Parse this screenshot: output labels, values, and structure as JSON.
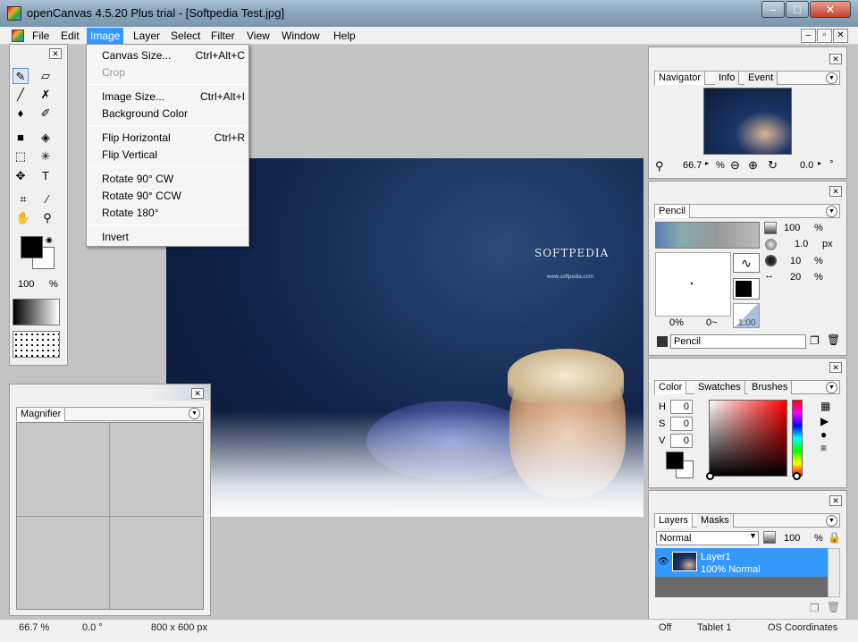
{
  "window": {
    "title": "openCanvas 4.5.20 Plus trial - [Softpedia Test.jpg]",
    "min": "–",
    "max": "□",
    "close": "✕"
  },
  "menubar": {
    "items": [
      "File",
      "Edit",
      "Image",
      "Layer",
      "Select",
      "Filter",
      "View",
      "Window",
      "Help"
    ],
    "mdi": [
      "–",
      "▫",
      "✕"
    ]
  },
  "image_menu": {
    "items": [
      {
        "label": "Canvas Size...",
        "shortcut": "Ctrl+Alt+C"
      },
      {
        "label": "Crop",
        "shortcut": ""
      },
      {
        "label": "Image Size...",
        "shortcut": "Ctrl+Alt+I"
      },
      {
        "label": "Background Color",
        "shortcut": ""
      },
      {
        "label": "Flip Horizontal",
        "shortcut": "Ctrl+R"
      },
      {
        "label": "Flip Vertical",
        "shortcut": ""
      },
      {
        "label": "Rotate 90° CW",
        "shortcut": ""
      },
      {
        "label": "Rotate 90° CCW",
        "shortcut": ""
      },
      {
        "label": "Rotate 180°",
        "shortcut": ""
      },
      {
        "label": "Invert",
        "shortcut": ""
      }
    ]
  },
  "toolbox": {
    "opacity": "100",
    "opacity_unit": "%",
    "close": "✕"
  },
  "canvas": {
    "logo_text": "SOFTPEDIA",
    "url_text": "www.softpedia.com"
  },
  "magnifier": {
    "tab": "Magnifier",
    "close": "✕"
  },
  "navigator": {
    "tabs": [
      "Navigator",
      "Info",
      "Event"
    ],
    "zoom": "66.7",
    "zoom_unit": "%",
    "angle": "0.0",
    "angle_unit": "°",
    "close": "✕"
  },
  "brush": {
    "tab": "Pencil",
    "density": "100",
    "density_unit": "%",
    "size": "1.0",
    "size_unit": "px",
    "hardness": "10",
    "hardness_unit": "%",
    "spacing": "20",
    "spacing_unit": "%",
    "preview_pct": "0%",
    "preview_min": "0~",
    "ratio": "1:00",
    "name": "Pencil",
    "close": "✕"
  },
  "color": {
    "tabs": [
      "Color",
      "Swatches",
      "Brushes"
    ],
    "h_label": "H",
    "h": "0",
    "s_label": "S",
    "s": "0",
    "v_label": "V",
    "v": "0",
    "close": "✕"
  },
  "layers": {
    "tabs": [
      "Layers",
      "Masks"
    ],
    "blend": "Normal",
    "opacity": "100",
    "opacity_unit": "%",
    "layer_name": "Layer1",
    "layer_info": "100% Normal",
    "close": "✕"
  },
  "status": {
    "zoom": "66.7 %",
    "angle": "0.0 °",
    "size": "800 x 600 px",
    "mode": "Off",
    "tablet": "Tablet 1",
    "coords": "OS Coordinates"
  }
}
